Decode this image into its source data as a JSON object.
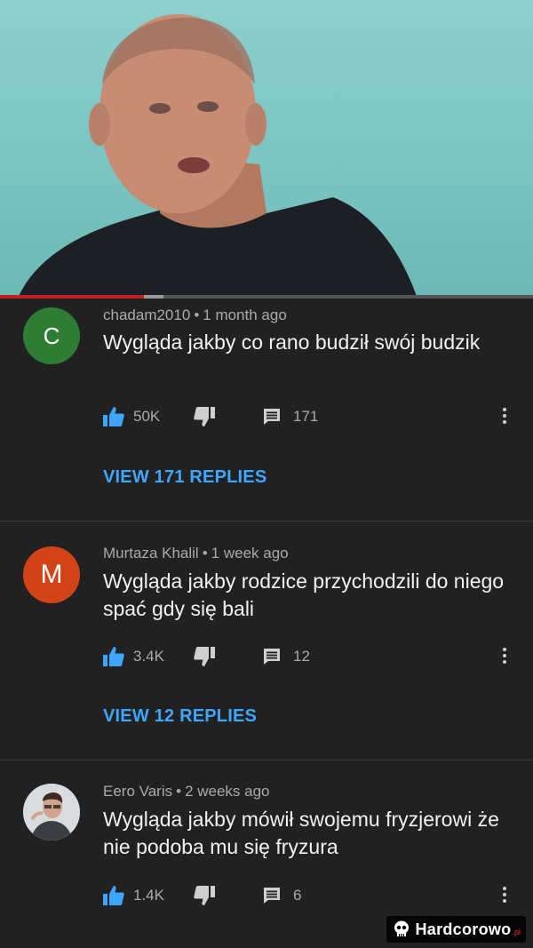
{
  "video": {
    "progress_fraction": 0.27,
    "colors": {
      "background": "#7cc5c2",
      "progress": "#c41f1f"
    }
  },
  "comments": [
    {
      "author": "chadam2010",
      "time": "1 month ago",
      "avatar_letter": "C",
      "avatar_color": "#2e7d32",
      "text": "Wygląda jakby co rano budził swój budzik",
      "likes": "50K",
      "replies_count": "171",
      "view_replies": "VIEW 171 REPLIES"
    },
    {
      "author": "Murtaza Khalil",
      "time": "1 week ago",
      "avatar_letter": "M",
      "avatar_color": "#d24418",
      "text": "Wygląda jakby rodzice przychodzili do niego spać gdy się bali",
      "likes": "3.4K",
      "replies_count": "12",
      "view_replies": "VIEW 12 REPLIES"
    },
    {
      "author": "Eero Varis",
      "time": "2 weeks ago",
      "avatar_icon": "user-photo-icon",
      "text": "Wygląda jakby mówił swojemu fryzjerowi że nie podoba mu się fryzura",
      "likes": "1.4K",
      "replies_count": "6"
    }
  ],
  "icons": {
    "like": "thumb-up-icon",
    "dislike": "thumb-down-icon",
    "reply": "comment-icon",
    "more": "more-vert-icon"
  },
  "theme": {
    "accent": "#3ea6ff",
    "background": "#212121",
    "meta_text": "#aaaaaa"
  },
  "watermark": {
    "brand": "Hardcorowo",
    "tld": ".pl"
  }
}
